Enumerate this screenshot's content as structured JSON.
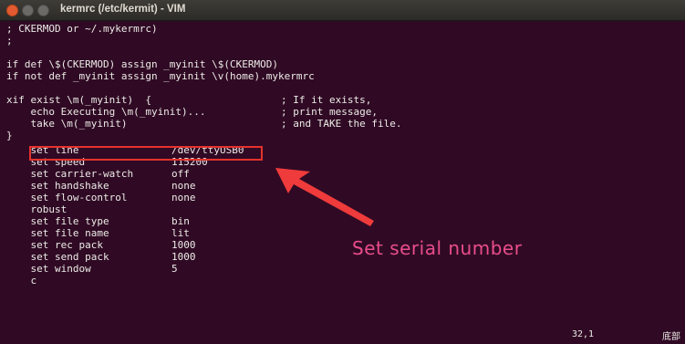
{
  "window": {
    "title": "kermrc (/etc/kermit) - VIM"
  },
  "editor": {
    "lines": [
      "; CKERMOD or ~/.mykermrc)",
      ";",
      "if def \\$(CKERMOD) assign _myinit \\$(CKERMOD)",
      "if not def _myinit assign _myinit \\v(home).mykermrc",
      "xif exist \\m(_myinit)  {",
      "    echo Executing \\m(_myinit)...",
      "    take \\m(_myinit)",
      "}"
    ],
    "comments": [
      "; If it exists,",
      "; print message,",
      "; and TAKE the file."
    ],
    "settings": [
      {
        "key": "    set line",
        "value": "/dev/ttyUSB0"
      },
      {
        "key": "    set speed",
        "value": "115200"
      },
      {
        "key": "    set carrier-watch",
        "value": "off"
      },
      {
        "key": "    set handshake",
        "value": "none"
      },
      {
        "key": "    set flow-control",
        "value": "none"
      },
      {
        "key": "    robust",
        "value": ""
      },
      {
        "key": "    set file type",
        "value": "bin"
      },
      {
        "key": "    set file name",
        "value": "lit"
      },
      {
        "key": "    set rec pack",
        "value": "1000"
      },
      {
        "key": "    set send pack",
        "value": "1000"
      },
      {
        "key": "    set window",
        "value": "5"
      },
      {
        "key": "    c",
        "value": ""
      }
    ],
    "cursor_position": "32,1",
    "status_right": "底部"
  },
  "annotation": {
    "label": "Set serial number",
    "color": "#e94d8a",
    "box_color": "#e5322b"
  },
  "colors": {
    "terminal_bg": "#300a24",
    "text": "#ecebe7"
  }
}
